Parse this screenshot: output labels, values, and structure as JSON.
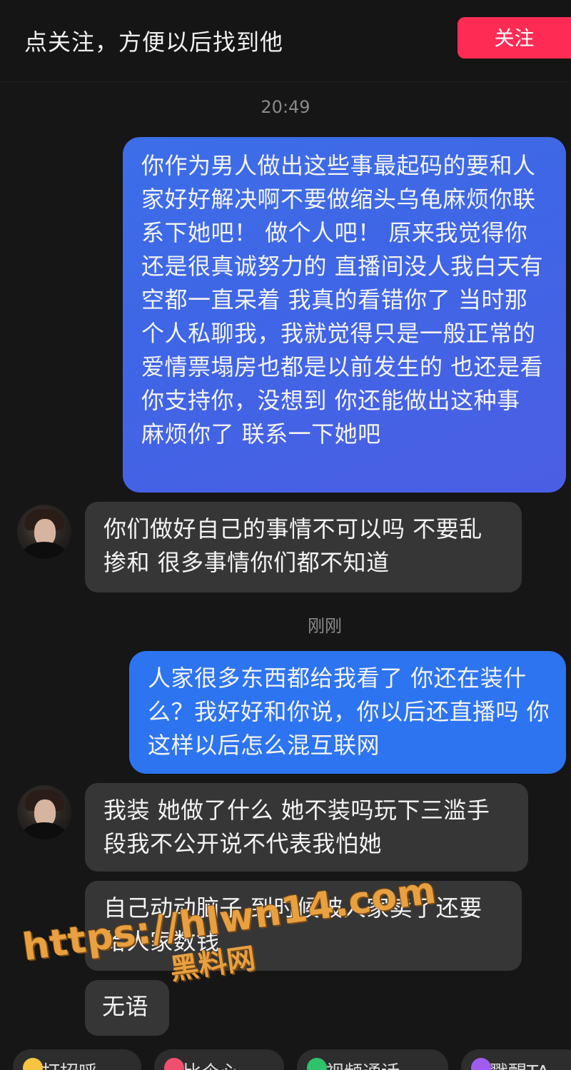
{
  "header": {
    "follow_prompt": "点关注，方便以后找到他",
    "follow_button": "关注"
  },
  "messages": [
    {
      "type": "timestamp",
      "text": "20:49"
    },
    {
      "type": "outgoing",
      "text": "你作为男人做出这些事最起码的要和人家好好解决啊不要做缩头乌龟麻烦你联系下她吧！ 做个人吧！ 原来我觉得你还是很真诚努力的 直播间没人我白天有空都一直呆着 我真的看错你了 当时那个人私聊我，我就觉得只是一般正常的爱情票塌房也都是以前发生的 也还是看你支持你，没想到 你还能做出这种事 麻烦你了 联系一下她吧"
    },
    {
      "type": "incoming",
      "text": "你们做好自己的事情不可以吗 不要乱掺和 很多事情你们都不知道"
    },
    {
      "type": "timestamp",
      "text": "刚刚"
    },
    {
      "type": "outgoing",
      "text": "人家很多东西都给我看了 你还在装什么？我好好和你说，你以后还直播吗 你这样以后怎么混互联网"
    },
    {
      "type": "incoming",
      "text": "我装 她做了什么 她不装吗玩下三滥手段我不公开说不代表我怕她"
    },
    {
      "type": "incoming",
      "text": "自己动动脑子 到时候被人家卖了还要给人家数钱"
    },
    {
      "type": "incoming",
      "text": "无语"
    }
  ],
  "watermark": {
    "url": "https://hlwn14.com",
    "brand": "黑料网"
  },
  "quick_actions": [
    {
      "label": "打招呼",
      "icon": "smile-icon",
      "color": "#f5c542"
    },
    {
      "label": "比个心",
      "icon": "heart-icon",
      "color": "#f0506e"
    },
    {
      "label": "视频通话",
      "icon": "video-icon",
      "color": "#2fc26b"
    },
    {
      "label": "戳醒TA",
      "icon": "poke-icon",
      "color": "#a05cf0"
    }
  ]
}
